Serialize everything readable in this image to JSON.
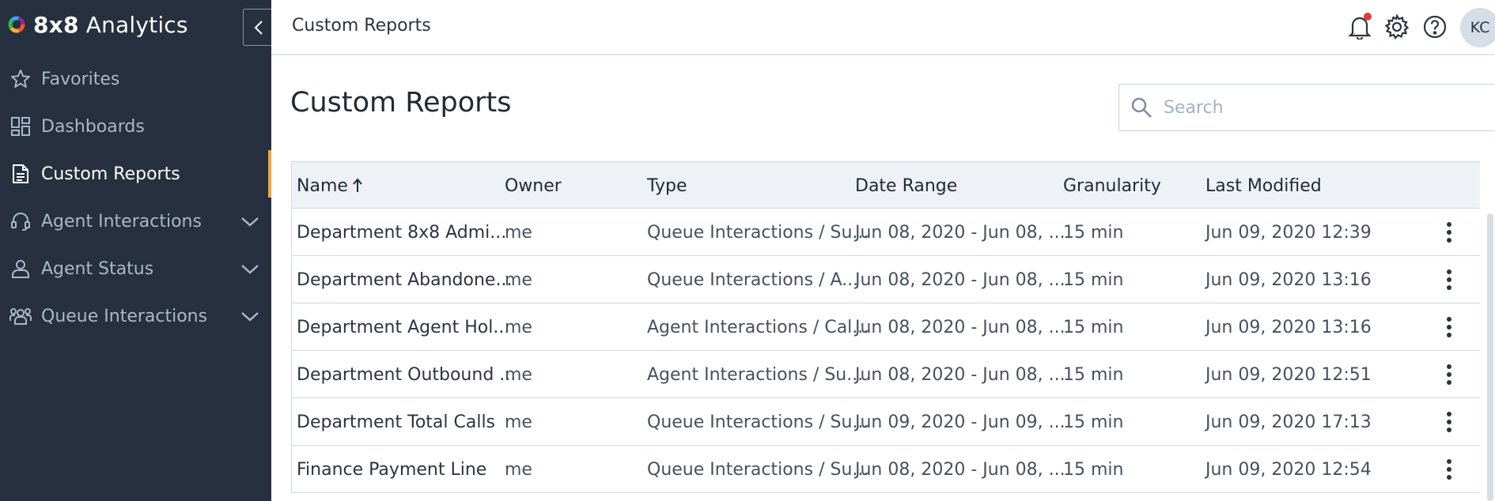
{
  "brand": {
    "bold": "8x8",
    "light": " Analytics",
    "logo_colors": [
      "#f15a24",
      "#fbb03b",
      "#39b54a",
      "#29abe2",
      "#93278f"
    ]
  },
  "sidebar": {
    "collapse_icon": "chevron-left-icon",
    "items": [
      {
        "label": "Favorites",
        "icon": "star-icon",
        "expandable": false
      },
      {
        "label": "Dashboards",
        "icon": "dashboard-grid-icon",
        "expandable": false
      },
      {
        "label": "Custom Reports",
        "icon": "document-icon",
        "expandable": false,
        "active": true
      },
      {
        "label": "Agent Interactions",
        "icon": "headset-icon",
        "expandable": true
      },
      {
        "label": "Agent Status",
        "icon": "person-icon",
        "expandable": true
      },
      {
        "label": "Queue Interactions",
        "icon": "group-icon",
        "expandable": true
      }
    ],
    "active_accent": "#f3a53c"
  },
  "topbar": {
    "title": "Custom Reports",
    "icons": [
      "bell-icon",
      "gear-icon",
      "help-icon"
    ],
    "avatar_initials": "KC"
  },
  "main": {
    "title": "Custom Reports",
    "search": {
      "placeholder": "Search",
      "value": ""
    }
  },
  "table": {
    "columns": [
      "Name",
      "Owner",
      "Type",
      "Date Range",
      "Granularity",
      "Last Modified"
    ],
    "sorted_column": "Name",
    "sort_direction": "ascending",
    "rows": [
      {
        "name": "Department 8x8 Admi...",
        "owner": "me",
        "type": "Queue Interactions / Su...",
        "date_range": "Jun 08, 2020 - Jun 08, ...",
        "granularity": "15 min",
        "last_modified": "Jun 09, 2020 12:39"
      },
      {
        "name": "Department Abandone...",
        "owner": "me",
        "type": "Queue Interactions / A...",
        "date_range": "Jun 08, 2020 - Jun 08, ...",
        "granularity": "15 min",
        "last_modified": "Jun 09, 2020 13:16"
      },
      {
        "name": "Department Agent Hol...",
        "owner": "me",
        "type": "Agent Interactions / Cal...",
        "date_range": "Jun 08, 2020 - Jun 08, ...",
        "granularity": "15 min",
        "last_modified": "Jun 09, 2020 13:16"
      },
      {
        "name": "Department Outbound ...",
        "owner": "me",
        "type": "Agent Interactions / Su...",
        "date_range": "Jun 08, 2020 - Jun 08, ...",
        "granularity": "15 min",
        "last_modified": "Jun 09, 2020 12:51"
      },
      {
        "name": "Department Total Calls",
        "owner": "me",
        "type": "Queue Interactions / Su...",
        "date_range": "Jun 09, 2020 - Jun 09, ...",
        "granularity": "15 min",
        "last_modified": "Jun 09, 2020 17:13"
      },
      {
        "name": "Finance Payment Line",
        "owner": "me",
        "type": "Queue Interactions / Su...",
        "date_range": "Jun 08, 2020 - Jun 08, ...",
        "granularity": "15 min",
        "last_modified": "Jun 09, 2020 12:54"
      }
    ]
  }
}
